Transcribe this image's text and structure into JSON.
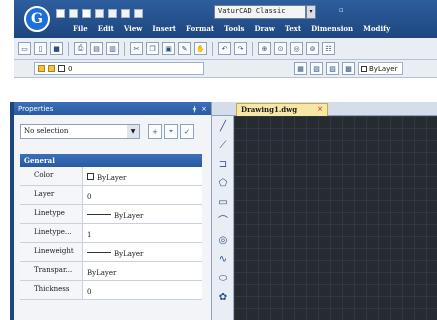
{
  "app": {
    "logo_letter": "G",
    "workspace": "VaturCAD Classic",
    "workspace_arrow": "▾",
    "title_more": "▫"
  },
  "menu": [
    "File",
    "Edit",
    "View",
    "Insert",
    "Format",
    "Tools",
    "Draw",
    "Text",
    "Dimension",
    "Modify"
  ],
  "toolbar1_icons": [
    "new-icon",
    "open-icon",
    "save-icon",
    "print-icon",
    "preview-icon",
    "plot-icon",
    "cut-icon",
    "copy-icon",
    "paste-icon",
    "match-icon",
    "pan-icon",
    "undo-icon",
    "redo-icon",
    "zoom-realtime-icon",
    "zoom-window-icon",
    "zoom-previous-icon",
    "zoom-extents-icon",
    "properties-icon"
  ],
  "toolbar2": {
    "layer_value": "0",
    "bylayer": "ByLayer"
  },
  "properties": {
    "title": "Properties",
    "pin": "ǂ",
    "close": "×",
    "selection": "No selection",
    "category": "General",
    "rows": [
      {
        "key": "Color",
        "value": "ByLayer"
      },
      {
        "key": "Layer",
        "value": "0"
      },
      {
        "key": "Linetype",
        "value": "ByLayer"
      },
      {
        "key": "Linetype...",
        "value": "1"
      },
      {
        "key": "Lineweight",
        "value": "ByLayer"
      },
      {
        "key": "Transpar...",
        "value": "ByLayer"
      },
      {
        "key": "Thickness",
        "value": "0"
      }
    ]
  },
  "document": {
    "tab": "Drawing1.dwg",
    "close": "×"
  },
  "draw_tools": [
    "line-icon",
    "polyline-icon",
    "arc-icon",
    "polygon-icon",
    "rectangle-icon",
    "arc-icon",
    "circle-icon",
    "spline-icon",
    "ellipse-icon",
    "revcloud-icon"
  ]
}
